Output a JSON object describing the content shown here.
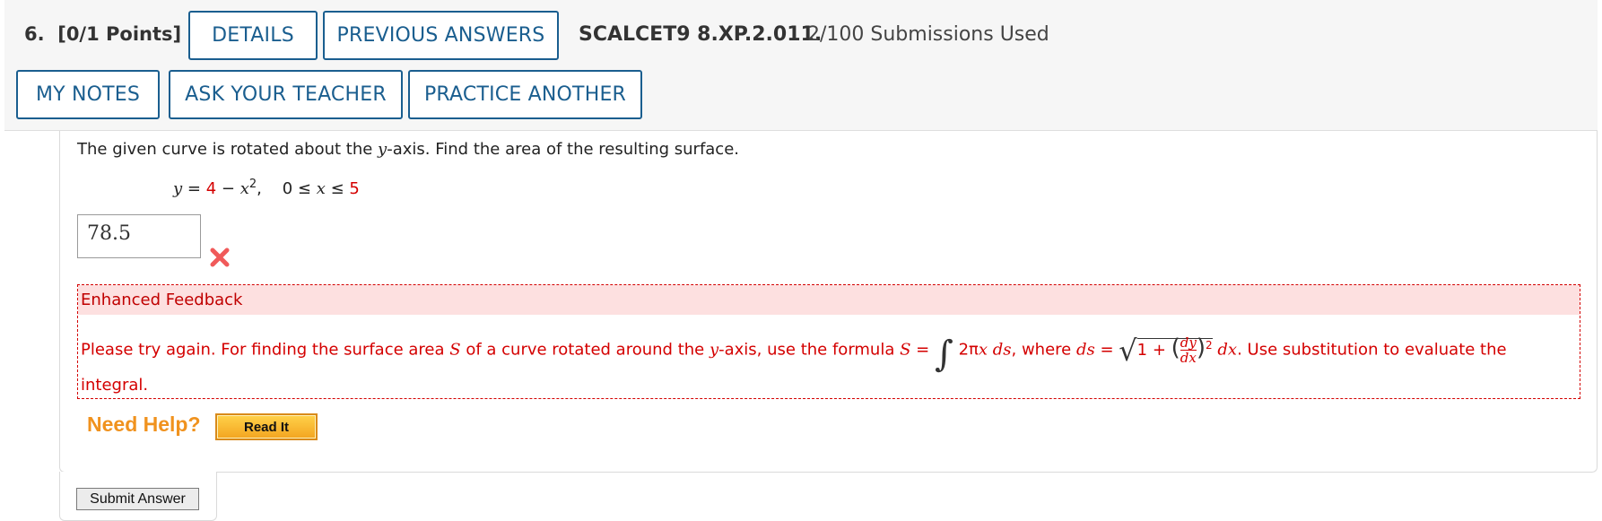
{
  "question": {
    "number": "6.",
    "points": "[0/1 Points]",
    "code": "SCALCET9 8.XP.2.011.",
    "submissions": "2/100 Submissions Used"
  },
  "buttons": {
    "details": "DETAILS",
    "previous_answers": "PREVIOUS ANSWERS",
    "my_notes": "MY NOTES",
    "ask_teacher": "ASK YOUR TEACHER",
    "practice_another": "PRACTICE ANOTHER"
  },
  "prompt": {
    "pre": "The given curve is rotated about the ",
    "var": "y",
    "post": "-axis. Find the area of the resulting surface."
  },
  "equation": {
    "y": "y",
    "eq": " = ",
    "a": "4",
    "minus": " − ",
    "x": "x",
    "sup": "2",
    "comma": ",",
    "range_start": "0 ≤ ",
    "range_x": "x",
    "range_le": " ≤ ",
    "b": "5"
  },
  "answer": {
    "value": "78.5",
    "status_icon": "x-mark-icon",
    "status_color": "#f05a5a"
  },
  "feedback": {
    "title": "Enhanced Feedback",
    "t1": "Please try again. For finding the surface area ",
    "S": "S",
    "t2": " of a curve rotated around the ",
    "yvar": "y",
    "t3": "-axis, use the formula ",
    "S2": "S",
    "eq": " = ",
    "integrand_2pi": "2π",
    "integrand_x": "x",
    "integrand_ds": "ds",
    "t4": ", where ",
    "ds": "ds",
    "eq2": " = ",
    "one_plus": "1 + ",
    "dy": "dy",
    "dx_frac": "dx",
    "exp": "2",
    "dx": "dx",
    "t5": ". Use substitution to evaluate the",
    "t6": "integral."
  },
  "help": {
    "label": "Need Help?",
    "read_it": "Read It"
  },
  "submit_label": "Submit Answer",
  "colors": {
    "accent": "#1a5e8f",
    "error": "#d40000",
    "feedback_bg": "#fde0e0",
    "help_orange": "#f0921e"
  }
}
